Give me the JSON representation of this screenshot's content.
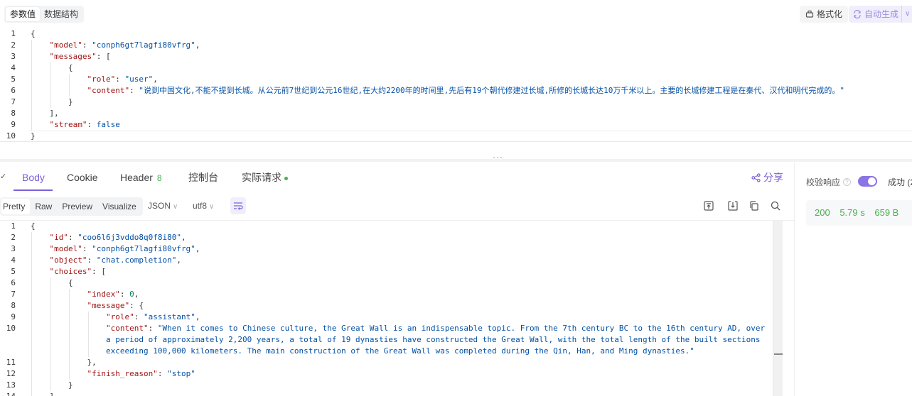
{
  "request": {
    "tabs": [
      "参数值",
      "数据结构"
    ],
    "format_button": "格式化",
    "auto_generate_button": "自动生成",
    "code_lines": [
      {
        "n": "1",
        "indent": 0,
        "parts": [
          {
            "t": "{",
            "c": ""
          }
        ]
      },
      {
        "n": "2",
        "indent": 1,
        "parts": [
          {
            "t": "\"model\"",
            "c": "k"
          },
          {
            "t": ": ",
            "c": ""
          },
          {
            "t": "\"conph6gt7lagfi80vfrg\"",
            "c": "s"
          },
          {
            "t": ",",
            "c": ""
          }
        ]
      },
      {
        "n": "3",
        "indent": 1,
        "parts": [
          {
            "t": "\"messages\"",
            "c": "k"
          },
          {
            "t": ": [",
            "c": ""
          }
        ]
      },
      {
        "n": "4",
        "indent": 2,
        "parts": [
          {
            "t": "{",
            "c": ""
          }
        ]
      },
      {
        "n": "5",
        "indent": 3,
        "parts": [
          {
            "t": "\"role\"",
            "c": "k"
          },
          {
            "t": ": ",
            "c": ""
          },
          {
            "t": "\"user\"",
            "c": "s"
          },
          {
            "t": ",",
            "c": ""
          }
        ]
      },
      {
        "n": "6",
        "indent": 3,
        "parts": [
          {
            "t": "\"content\"",
            "c": "k"
          },
          {
            "t": ": ",
            "c": ""
          },
          {
            "t": "\"说到中国文化,不能不提到长城。从公元前7世纪到公元16世纪,在大约2200年的时间里,先后有19个朝代修建过长城,所修的长城长达10万千米以上。主要的长城修建工程是在秦代、汉代和明代完成的。\"",
            "c": "s"
          }
        ]
      },
      {
        "n": "7",
        "indent": 2,
        "parts": [
          {
            "t": "}",
            "c": ""
          }
        ]
      },
      {
        "n": "8",
        "indent": 1,
        "parts": [
          {
            "t": "],",
            "c": ""
          }
        ]
      },
      {
        "n": "9",
        "indent": 1,
        "parts": [
          {
            "t": "\"stream\"",
            "c": "k"
          },
          {
            "t": ": ",
            "c": ""
          },
          {
            "t": "false",
            "c": "b"
          }
        ]
      },
      {
        "n": "10",
        "indent": 0,
        "parts": [
          {
            "t": "}",
            "c": ""
          }
        ]
      }
    ]
  },
  "response": {
    "tabs": {
      "body": "Body",
      "cookie": "Cookie",
      "header": "Header",
      "header_count": "8",
      "console": "控制台",
      "actual_request": "实际请求"
    },
    "share": "分享",
    "view_modes": [
      "Pretty",
      "Raw",
      "Preview",
      "Visualize"
    ],
    "format_select": "JSON",
    "encoding_select": "utf8",
    "code_lines": [
      {
        "n": "1",
        "indent": 0,
        "parts": [
          {
            "t": "{",
            "c": ""
          }
        ]
      },
      {
        "n": "2",
        "indent": 1,
        "parts": [
          {
            "t": "\"id\"",
            "c": "k"
          },
          {
            "t": ": ",
            "c": ""
          },
          {
            "t": "\"coo6l6j3vddo8q0f8i80\"",
            "c": "s"
          },
          {
            "t": ",",
            "c": ""
          }
        ]
      },
      {
        "n": "3",
        "indent": 1,
        "parts": [
          {
            "t": "\"model\"",
            "c": "k"
          },
          {
            "t": ": ",
            "c": ""
          },
          {
            "t": "\"conph6gt7lagfi80vfrg\"",
            "c": "s"
          },
          {
            "t": ",",
            "c": ""
          }
        ]
      },
      {
        "n": "4",
        "indent": 1,
        "parts": [
          {
            "t": "\"object\"",
            "c": "k"
          },
          {
            "t": ": ",
            "c": ""
          },
          {
            "t": "\"chat.completion\"",
            "c": "s"
          },
          {
            "t": ",",
            "c": ""
          }
        ]
      },
      {
        "n": "5",
        "indent": 1,
        "parts": [
          {
            "t": "\"choices\"",
            "c": "k"
          },
          {
            "t": ": [",
            "c": ""
          }
        ]
      },
      {
        "n": "6",
        "indent": 2,
        "parts": [
          {
            "t": "{",
            "c": ""
          }
        ]
      },
      {
        "n": "7",
        "indent": 3,
        "parts": [
          {
            "t": "\"index\"",
            "c": "k"
          },
          {
            "t": ": ",
            "c": ""
          },
          {
            "t": "0",
            "c": "n"
          },
          {
            "t": ",",
            "c": ""
          }
        ]
      },
      {
        "n": "8",
        "indent": 3,
        "parts": [
          {
            "t": "\"message\"",
            "c": "k"
          },
          {
            "t": ": {",
            "c": ""
          }
        ]
      },
      {
        "n": "9",
        "indent": 4,
        "parts": [
          {
            "t": "\"role\"",
            "c": "k"
          },
          {
            "t": ": ",
            "c": ""
          },
          {
            "t": "\"assistant\"",
            "c": "s"
          },
          {
            "t": ",",
            "c": ""
          }
        ]
      },
      {
        "n": "10",
        "indent": 4,
        "parts": [
          {
            "t": "\"content\"",
            "c": "k"
          },
          {
            "t": ": ",
            "c": ""
          },
          {
            "t": "\"When it comes to Chinese culture, the Great Wall is an indispensable topic. From the 7th century BC to the 16th century AD, over",
            "c": "s"
          }
        ]
      },
      {
        "n": "",
        "indent": 4,
        "parts": [
          {
            "t": "a period of approximately 2,200 years, a total of 19 dynasties have constructed the Great Wall, with the total length of the built sections",
            "c": "s"
          }
        ]
      },
      {
        "n": "",
        "indent": 4,
        "parts": [
          {
            "t": "exceeding 100,000 kilometers. The main construction of the Great Wall was completed during the Qin, Han, and Ming dynasties.\"",
            "c": "s"
          }
        ]
      },
      {
        "n": "11",
        "indent": 3,
        "parts": [
          {
            "t": "},",
            "c": ""
          }
        ]
      },
      {
        "n": "12",
        "indent": 3,
        "parts": [
          {
            "t": "\"finish_reason\"",
            "c": "k"
          },
          {
            "t": ": ",
            "c": ""
          },
          {
            "t": "\"stop\"",
            "c": "s"
          }
        ]
      },
      {
        "n": "13",
        "indent": 2,
        "parts": [
          {
            "t": "}",
            "c": ""
          }
        ]
      },
      {
        "n": "14",
        "indent": 1,
        "parts": [
          {
            "t": "],",
            "c": ""
          }
        ]
      }
    ]
  },
  "validation": {
    "label": "校验响应",
    "enabled": true,
    "result": "成功 (2",
    "status_code": "200",
    "time": "5.79 s",
    "size": "659 B"
  },
  "colors": {
    "accent": "#7b61d6",
    "success": "#4caf50",
    "json_key": "#a31515",
    "json_string": "#0451a5"
  }
}
